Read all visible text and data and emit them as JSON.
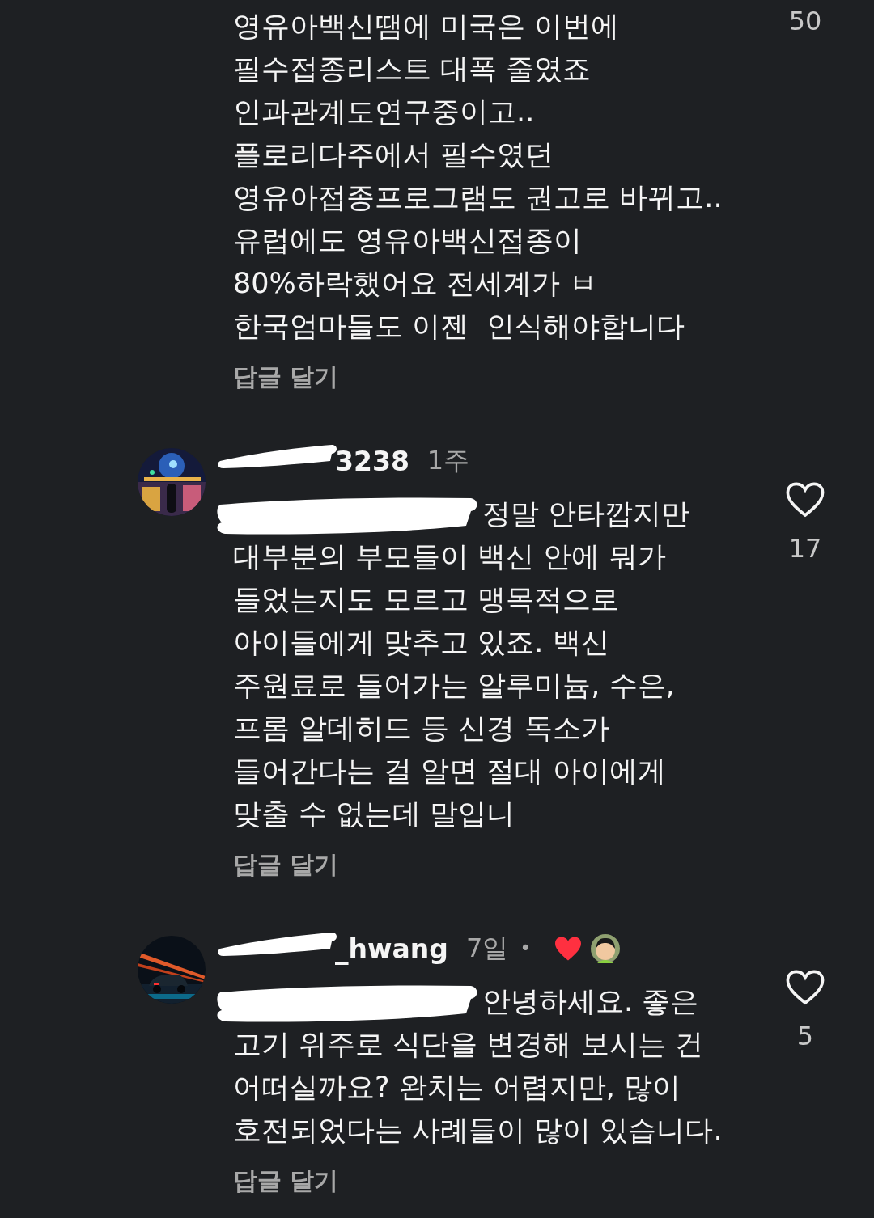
{
  "comments": [
    {
      "avatar": false,
      "text": "영유아백신땜에 미국은 이번에\n필수접종리스트 대폭 줄였죠\n인과관계도연구중이고..\n플로리다주에서 필수였던\n영유아접종프로그램도 권고로 바뀌고..\n유럽에도 영유아백신접종이\n80%하락했어요 전세계가 ㅂ\n한국엄마들도 이젠  인식해야합니다",
      "reply": "답글 달기",
      "heart_shown": false,
      "likes": "50"
    },
    {
      "username": "3238",
      "username_redacted": true,
      "time": "1주",
      "avatar": true,
      "mention_redacted": true,
      "text": "정말 안타깝지만\n대부분의 부모들이 백신 안에 뭐가\n들었는지도 모르고 맹목적으로\n아이들에게 맞추고 있죠. 백신\n주원료로 들어가는 알루미늄, 수은,\n프롬 알데히드 등 신경 독소가\n들어간다는 걸 알면 절대 아이에게\n맞출 수 없는데 말입니",
      "reply": "답글 달기",
      "heart_shown": true,
      "likes": "17"
    },
    {
      "username": "_hwang",
      "username_redacted": true,
      "time": "7일",
      "separator": "•",
      "liked_by_creator": true,
      "avatar": true,
      "mention_redacted": true,
      "text": "안녕하세요. 좋은\n고기 위주로 식단을 변경해 보시는 건\n어떠실까요? 완치는 어렵지만, 많이\n호전되었다는 사례들이 많이 있습니다.",
      "reply": "답글 달기",
      "heart_shown": true,
      "likes": "5"
    }
  ]
}
